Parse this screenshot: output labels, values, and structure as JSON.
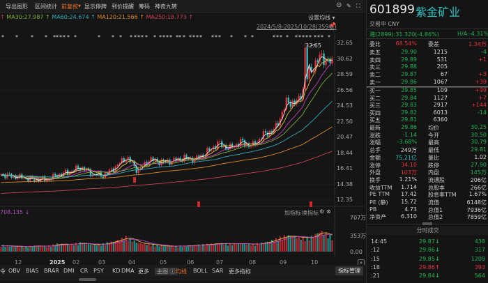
{
  "menu": [
    "导出图形",
    "区间统计",
    "前复权",
    "显示停牌",
    "到价提醒",
    "筹码",
    "神奇九转"
  ],
  "ma_header": [
    {
      "label": "MA30:27.987",
      "color": "#7fb03a"
    },
    {
      "label": "MA60:24.674",
      "color": "#33aabb"
    },
    {
      "label": "MA120:21.566",
      "color": "#e08a2a"
    },
    {
      "label": "MA250:18.773",
      "color": "#d0405a"
    }
  ],
  "set_ma": "设置均线 ▾",
  "range": "2024/5/8-2025/10/28(359根)",
  "peak_label": "32.65",
  "price_axis": [
    "32.65",
    "30.62",
    "28.59",
    "26.56",
    "24.53",
    "22.50",
    "20.47",
    "18.44",
    "16.41",
    "14.38",
    "12.35"
  ],
  "vol_header": "708.135 ↓",
  "vol_buttons": [
    "加指标",
    "换指标"
  ],
  "vol_axis": [
    "707万",
    "353万",
    "0.00"
  ],
  "months": [
    "12",
    "2025",
    "02",
    "03",
    "04",
    "05",
    "06",
    "07",
    "08",
    "09",
    "10"
  ],
  "indicator_tabs": [
    "令",
    "OBV",
    "BIAS",
    "BRAR",
    "DMI",
    "CR",
    "PSY",
    "KD",
    "DMA",
    "更多"
  ],
  "main_tabs": [
    "主图 ⓘ",
    "均线",
    "BOLL",
    "SAR",
    "更多指标"
  ],
  "indicator_mgmt": "指标管理",
  "colors": {
    "up": "#e8323c",
    "down": "#2ec4c4",
    "bg": "#151515"
  },
  "chart_data": {
    "type": "candlestick",
    "title": "601899 紫金矿业",
    "period": "2024/5/8-2025/10/28",
    "close_samples": [
      15.7,
      15.4,
      15.2,
      15.0,
      15.0,
      15.6,
      16.0,
      16.6,
      15.7,
      15.5,
      16.6,
      17.9,
      16.1,
      17.6,
      17.3,
      17.4,
      17.8,
      17.6,
      18.5,
      19.7,
      19.0,
      19.9,
      19.3,
      20.8,
      21.5,
      25.0,
      25.0,
      28.9,
      31.0,
      30.0
    ],
    "volume_samples": [
      130,
      110,
      100,
      120,
      110,
      160,
      150,
      180,
      140,
      160,
      220,
      300,
      180,
      150,
      120,
      110,
      120,
      130,
      150,
      170,
      160,
      170,
      150,
      180,
      250,
      330,
      300,
      280,
      420,
      300
    ],
    "peak": 32.65,
    "ylim": [
      12.35,
      32.65
    ],
    "vol_lim": [
      0,
      707
    ]
  },
  "quote": {
    "code": "601899",
    "name": "紫金矿业",
    "status": "交易中 CNY",
    "hk": "港(2899):31.320(-4.86%)",
    "ha": "H/A:-4.31%",
    "wb_label": "委比",
    "wb": "68.54%",
    "wc_label": "委差",
    "wc": "1.34万",
    "asks": [
      {
        "l": "卖五",
        "p": "29.90",
        "q": "1215",
        "c": "-4"
      },
      {
        "l": "卖四",
        "p": "29.89",
        "q": "531",
        "c": "+1"
      },
      {
        "l": "卖三",
        "p": "29.88",
        "q": "205",
        "c": ""
      },
      {
        "l": "卖二",
        "p": "29.87",
        "q": "67",
        "c": "+3"
      },
      {
        "l": "卖一",
        "p": "29.86",
        "q": "1067",
        "c": "+39"
      }
    ],
    "bids": [
      {
        "l": "买一",
        "p": "29.85",
        "q": "109",
        "c": "+99"
      },
      {
        "l": "买二",
        "p": "29.84",
        "q": "1127",
        "c": "+7"
      },
      {
        "l": "买三",
        "p": "29.83",
        "q": "2917",
        "c": "+144"
      },
      {
        "l": "买四",
        "p": "29.82",
        "q": "6013",
        "c": "-14"
      },
      {
        "l": "买五",
        "p": "29.81",
        "q": "6360",
        "c": ""
      }
    ],
    "stats": [
      {
        "l1": "最新",
        "v1": "29.86",
        "c1": "g",
        "l2": "均价",
        "v2": "30.25",
        "c2": "g"
      },
      {
        "l1": "涨跌",
        "v1": "-1.14",
        "c1": "g",
        "l2": "今开",
        "v2": "30.50",
        "c2": "g"
      },
      {
        "l1": "涨幅",
        "v1": "-3.68%",
        "c1": "g",
        "l2": "最高",
        "v2": "30.79",
        "c2": "g"
      },
      {
        "l1": "总手",
        "v1": "249万",
        "c1": "w",
        "l2": "最低",
        "v2": "29.81",
        "c2": "g"
      },
      {
        "l1": "金额",
        "v1": "75.21亿",
        "c1": "t",
        "l2": "量比",
        "v2": "1.02",
        "c2": "w"
      },
      {
        "l1": "涨停",
        "v1": "34.10",
        "c1": "r",
        "l2": "跌停",
        "v2": "27.90",
        "c2": "g"
      },
      {
        "l1": "外盘",
        "v1": "103万",
        "c1": "r",
        "l2": "内盘",
        "v2": "145万",
        "c2": "g"
      },
      {
        "l1": "换手",
        "v1": "1.21%",
        "c1": "w",
        "l2": "流通股",
        "v2": "206亿",
        "c2": "w"
      },
      {
        "l1": "收益TTM",
        "v1": "1.714",
        "c1": "w",
        "l2": "总股本",
        "v2": "266亿",
        "c2": "w"
      },
      {
        "l1": "PE TTM",
        "v1": "17.42",
        "c1": "w",
        "l2": "股息率TTM",
        "v2": "1.67%",
        "c2": "w"
      },
      {
        "l1": "PE (静)",
        "v1": "15.72",
        "c1": "w",
        "l2": "流值",
        "v2": "6148亿",
        "c2": "w"
      },
      {
        "l1": "PB",
        "v1": "4.73",
        "c1": "w",
        "l2": "总值1",
        "v2": "7936亿",
        "c2": "w"
      },
      {
        "l1": "净资产",
        "v1": "6.310",
        "c1": "w",
        "l2": "总值2",
        "v2": "7859亿",
        "c2": "w"
      }
    ],
    "ticks_title": "分时成交",
    "ticks": [
      {
        "t": "14:45",
        "p": "29.87",
        "d": "↓",
        "v": "438",
        "c": "g"
      },
      {
        "t": ":12",
        "p": "29.86",
        "d": "↓",
        "v": "317",
        "c": "g"
      },
      {
        "t": ":15",
        "p": "29.85",
        "d": "↓",
        "v": "1209",
        "c": "g"
      },
      {
        "t": ":18",
        "p": "29.86",
        "d": "↑",
        "v": "393",
        "c": "r"
      },
      {
        "t": ":21",
        "p": "29.84",
        "d": "↓",
        "v": "564",
        "c": "g"
      }
    ]
  }
}
